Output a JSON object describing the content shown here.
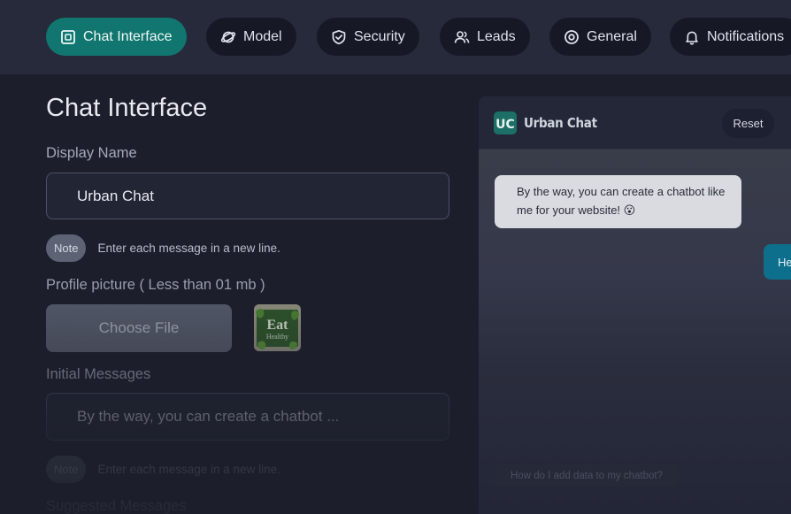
{
  "nav": {
    "tabs": [
      {
        "label": "Chat Interface",
        "icon": "chat-square-icon",
        "active": true
      },
      {
        "label": "Model",
        "icon": "planet-icon",
        "active": false
      },
      {
        "label": "Security",
        "icon": "shield-icon",
        "active": false
      },
      {
        "label": "Leads",
        "icon": "users-icon",
        "active": false
      },
      {
        "label": "General",
        "icon": "target-icon",
        "active": false
      },
      {
        "label": "Notifications",
        "icon": "bell-icon",
        "active": false
      }
    ]
  },
  "form": {
    "title": "Chat Interface",
    "display_name_label": "Display Name",
    "display_name_value": "Urban Chat",
    "note_badge": "Note",
    "note_text": "Enter each message in a new line.",
    "profile_picture_label": "Profile picture ( Less than 01 mb )",
    "choose_file_label": "Choose File",
    "profile_thumb_text_1": "Eat",
    "profile_thumb_text_2": "Healthy",
    "initial_messages_label": "Initial Messages",
    "initial_messages_value": "By the way, you can create a chatbot ...",
    "note_badge_2": "Note",
    "note_text_2": "Enter each message in a new line.",
    "suggested_messages_label": "Suggested Messages"
  },
  "preview": {
    "brand_logo_text": "UC",
    "brand_name": "Urban Chat",
    "reset_label": "Reset",
    "bot_message": "By the way, you can create a chatbot like me for your website! 😮",
    "user_message": "He",
    "suggestion": "How do I add data to my chatbot?"
  },
  "colors": {
    "accent": "#11766f",
    "user_bubble": "#0e6f8c",
    "background": "#1c1f2b"
  }
}
